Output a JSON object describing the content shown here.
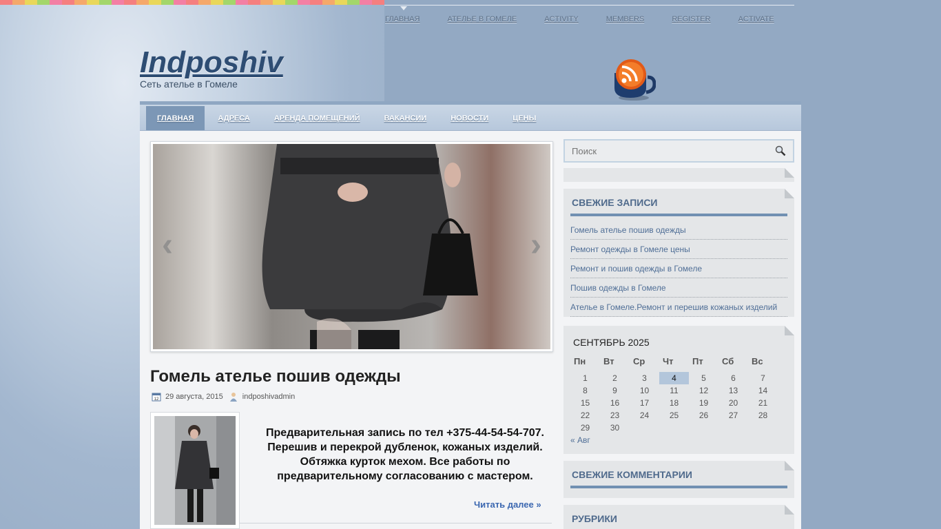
{
  "site": {
    "title": "Indposhiv",
    "tagline": "Сеть ателье в Гомеле"
  },
  "top_nav": {
    "items": [
      "Главная",
      "Ателье в Гомеле",
      "Activity",
      "Members",
      "Register",
      "Activate"
    ],
    "active": "Главная"
  },
  "main_nav": {
    "items": [
      "Главная",
      "Адреса",
      "Аренда помещений",
      "Вакансии",
      "Новости",
      "Цены"
    ],
    "active": "Главная"
  },
  "slider": {
    "prev_glyph": "‹",
    "next_glyph": "›"
  },
  "post": {
    "title": "Гомель ателье пошив одежды",
    "date": "29 августа, 2015",
    "author": "indposhivadmin",
    "excerpt": "Предварительная запись по тел +375-44-54-54-707. Перешив и перекрой дубленок, кожаных изделий. Обтяжка курток мехом. Все работы по предварительному согласованию с мастером.",
    "read_more": "Читать далее »"
  },
  "search": {
    "placeholder": "Поиск"
  },
  "recent_posts": {
    "title": "Свежие записи",
    "items": [
      "Гомель ателье пошив одежды",
      "Ремонт одежды в Гомеле цены",
      "Ремонт и пошив одежды в Гомеле",
      "Пошив одежды в Гомеле",
      "Ателье в Гомеле.Ремонт и перешив кожаных изделий"
    ]
  },
  "calendar": {
    "title": "СЕНТЯБРЬ 2025",
    "weekdays": [
      "Пн",
      "Вт",
      "Ср",
      "Чт",
      "Пт",
      "Сб",
      "Вс"
    ],
    "weeks": [
      [
        "1",
        "2",
        "3",
        "4",
        "5",
        "6",
        "7"
      ],
      [
        "8",
        "9",
        "10",
        "11",
        "12",
        "13",
        "14"
      ],
      [
        "15",
        "16",
        "17",
        "18",
        "19",
        "20",
        "21"
      ],
      [
        "22",
        "23",
        "24",
        "25",
        "26",
        "27",
        "28"
      ],
      [
        "29",
        "30",
        "",
        "",
        "",
        "",
        ""
      ]
    ],
    "today": "4",
    "prev_link": "« Авг"
  },
  "recent_comments": {
    "title": "Свежие комментарии"
  },
  "categories": {
    "title": "Рубрики"
  },
  "colors": {
    "accent": "#7190b2",
    "link": "#4f6e96",
    "logo": "#2e4d73"
  },
  "icons": [
    "rss-cup-icon",
    "calendar-icon",
    "author-icon",
    "search-icon"
  ]
}
